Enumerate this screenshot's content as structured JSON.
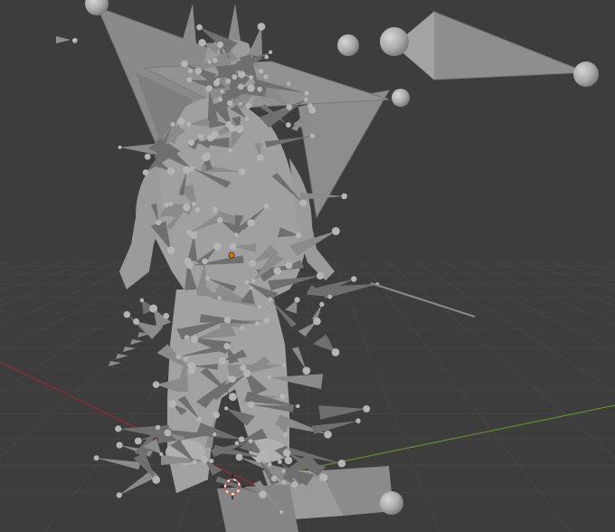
{
  "viewport": {
    "background": "#3d3d3d",
    "grid_color": "#444444",
    "x_axis_color": "#8c2b35",
    "y_axis_color": "#5f8a2c",
    "mesh_color": "#9d9d9d",
    "mesh_dark": "#6f6f6f",
    "bone_color": "#8b8b8b",
    "bone_light": "#a9a9a9",
    "sphere_color": "#b5b5b5",
    "origin_color": "#e07b00",
    "cursor_color": "#d05050"
  },
  "icons": {
    "origin": "origin-dot-icon",
    "cursor": "3d-cursor-icon"
  }
}
